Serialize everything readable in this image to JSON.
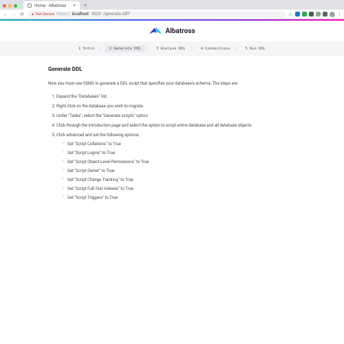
{
  "browser": {
    "tab_title": "Home · Albatross",
    "url_insecure_label": "Not Secure",
    "url_prefix": "https://",
    "url_host": "localhost",
    "url_port": ":9020",
    "url_path": "/generate-ddl?"
  },
  "brand": {
    "name": "Albatross"
  },
  "stepper": {
    "items": [
      {
        "num": "1",
        "label": "Intro"
      },
      {
        "num": "2",
        "label": "Generate DDL"
      },
      {
        "num": "3",
        "label": "Analyze DDL"
      },
      {
        "num": "4",
        "label": "Connections"
      },
      {
        "num": "5",
        "label": "Run DDL"
      }
    ],
    "active_index": 1
  },
  "page": {
    "heading": "Generate DDL",
    "intro": "Now you must use SSMS to generate a DDL script that specifies your database's schema. The steps are:",
    "steps": [
      "Expand the \"Databases\" list.",
      "Right click on the database you wish to migrate.",
      "Under \"Tasks\", select the \"Generate scripts\" option",
      "Click through the introduction page and select the option to script entire database and all database objects.",
      "Click advanced and set the following options:"
    ],
    "options": [
      "Set \"Script Collations\" to True",
      "Set \"Script Logins\" to True",
      "Set \"Script Object-Level Permissions\" to True",
      "Set \"Script Owner\" to True",
      "Set \"Script Change Tracking\" to True",
      "Set \"Script Full-Text Indexes\" to True",
      "Set \"Script Triggers\" to True"
    ]
  }
}
